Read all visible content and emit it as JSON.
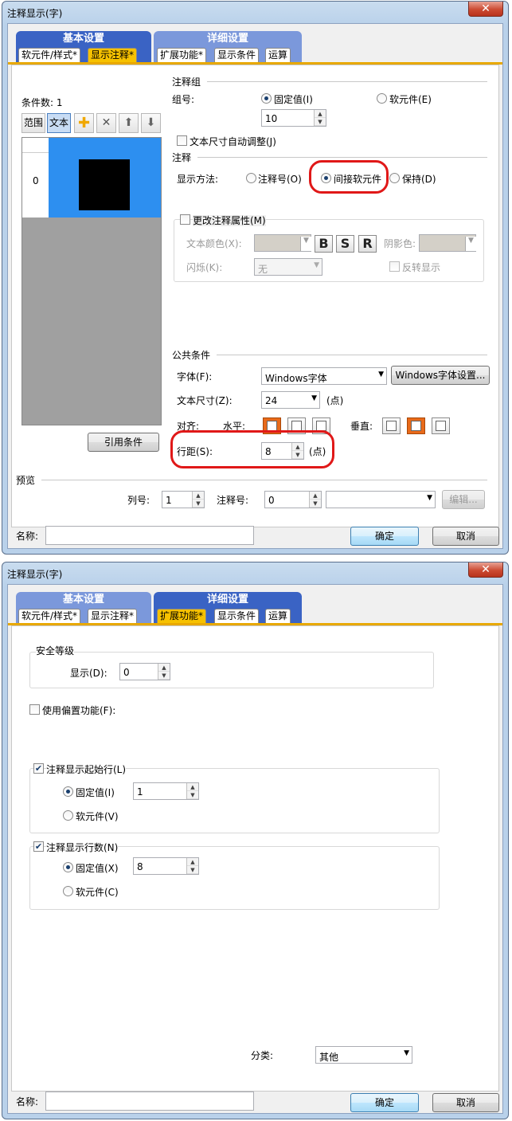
{
  "dialog1": {
    "title": "注释显示(字)",
    "close_glyph": "✕",
    "tab_basic": "基本设置",
    "tab_detail": "详细设置",
    "subtab_device_style": "软元件/样式*",
    "subtab_display_comment": "显示注释*",
    "subtab_extension": "扩展功能*",
    "subtab_display_condition": "显示条件",
    "subtab_operation": "运算",
    "condition_count_label": "条件数: 1",
    "tool_range": "范围",
    "tool_text": "文本",
    "list_row_index": "0",
    "ref_condition_button": "引用条件",
    "comment_group_header": "注释组",
    "group_no_label": "组号:",
    "radio_fixed": "固定值(I)",
    "radio_device": "软元件(E)",
    "group_no_value": "10",
    "auto_size_check": "文本尺寸自动调整(J)",
    "comment_header": "注释",
    "display_method_label": "显示方法:",
    "radio_comment_no": "注释号(O)",
    "radio_indirect_device": "间接软元件",
    "radio_keep": "保持(D)",
    "change_attr_check": "更改注释属性(M)",
    "text_color_label": "文本颜色(X):",
    "btn_bold": "B",
    "btn_shadow": "S",
    "btn_reverse": "R",
    "shadow_color_label": "阴影色:",
    "blink_label": "闪烁(K):",
    "blink_value": "无",
    "reverse_display_check": "反转显示",
    "common_cond_header": "公共条件",
    "font_label": "字体(F):",
    "font_value": "Windows字体",
    "font_settings_button": "Windows字体设置...",
    "text_size_label": "文本尺寸(Z):",
    "text_size_value": "24",
    "points_unit": "(点)",
    "align_label": "对齐:",
    "horizontal_label": "水平:",
    "vertical_label": "垂直:",
    "line_spacing_label": "行距(S):",
    "line_spacing_value": "8",
    "line_spacing_unit": "(点)",
    "preview_header": "预览",
    "column_no_label": "列号:",
    "column_no_value": "1",
    "comment_no_label": "注释号:",
    "comment_no_value": "0",
    "edit_button": "编辑...",
    "name_label": "名称:",
    "ok_button": "确定",
    "cancel_button": "取消"
  },
  "dialog2": {
    "title": "注释显示(字)",
    "close_glyph": "✕",
    "tab_basic": "基本设置",
    "tab_detail": "详细设置",
    "subtab_device_style": "软元件/样式*",
    "subtab_display_comment": "显示注释*",
    "subtab_extension": "扩展功能*",
    "subtab_display_condition": "显示条件",
    "subtab_operation": "运算",
    "security_header": "安全等级",
    "display_label": "显示(D):",
    "display_value": "0",
    "offset_check": "使用偏置功能(F):",
    "start_row_check": "注释显示起始行(L)",
    "start_fixed": "固定值(I)",
    "start_fixed_value": "1",
    "start_device": "软元件(V)",
    "row_count_check": "注释显示行数(N)",
    "count_fixed": "固定值(X)",
    "count_fixed_value": "8",
    "count_device": "软元件(C)",
    "category_label": "分类:",
    "category_value": "其他",
    "name_label": "名称:",
    "ok_button": "确定",
    "cancel_button": "取消"
  },
  "colors": {
    "tab_blue": "#3a63c4",
    "active_orange": "#f6c100",
    "highlight_red": "#e01818",
    "list_selected": "#2d8ff0"
  }
}
